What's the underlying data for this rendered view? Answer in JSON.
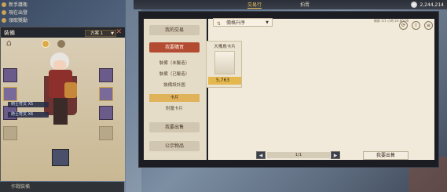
{
  "top_left": {
    "line1": "新手護衛",
    "line2": "現在出發",
    "line3": "領取獎勵"
  },
  "topbar": {
    "tabs": [
      "交易行",
      "拍賣"
    ],
    "active_tab": 0,
    "currency": "2,244,214"
  },
  "equip": {
    "title": "裝備",
    "plan": "方案 1",
    "skills": [
      "術士符文 X5",
      "術士符文 X6"
    ],
    "footer": "作戰裝備"
  },
  "trade": {
    "sort_label": "價格升序",
    "sidebar": {
      "my_trade": "我的交易",
      "my_market": "我要購買",
      "sub_items": [
        "裝備（未鑿造）",
        "裝備（已鑿造）",
        "裝備設計圖",
        "卡片",
        "附魔卡片"
      ],
      "active_sub": 3,
      "materials": "我要出售",
      "notices": "公示物品"
    },
    "card": {
      "name": "大嘴鳥卡片",
      "price": "5,763"
    },
    "info": "剩餘 1/1 小時 24:00:00",
    "page": "1/1",
    "sell_button": "我要出售"
  },
  "icons": {
    "coin": "silver-coin-icon",
    "close": "close-icon",
    "sort": "sort-icon"
  }
}
